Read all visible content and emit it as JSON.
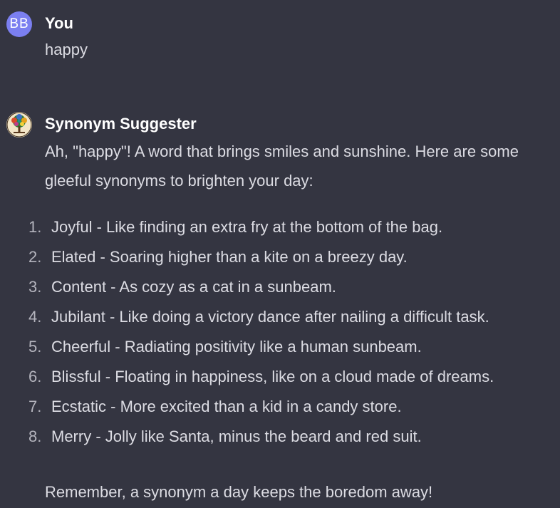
{
  "user_message": {
    "avatar_initials": "BB",
    "sender": "You",
    "text": "happy"
  },
  "assistant_message": {
    "avatar_icon": "tree-logo-icon",
    "sender": "Synonym Suggester",
    "intro": "Ah, \"happy\"! A word that brings smiles and sunshine. Here are some gleeful synonyms to brighten your day:",
    "items": [
      {
        "num": "1.",
        "text": "Joyful - Like finding an extra fry at the bottom of the bag."
      },
      {
        "num": "2.",
        "text": "Elated - Soaring higher than a kite on a breezy day."
      },
      {
        "num": "3.",
        "text": "Content - As cozy as a cat in a sunbeam."
      },
      {
        "num": "4.",
        "text": "Jubilant - Like doing a victory dance after nailing a difficult task."
      },
      {
        "num": "5.",
        "text": "Cheerful - Radiating positivity like a human sunbeam."
      },
      {
        "num": "6.",
        "text": "Blissful - Floating in happiness, like on a cloud made of dreams."
      },
      {
        "num": "7.",
        "text": "Ecstatic - More excited than a kid in a candy store."
      },
      {
        "num": "8.",
        "text": "Merry - Jolly like Santa, minus the beard and red suit."
      }
    ],
    "closing": "Remember, a synonym a day keeps the boredom away!"
  },
  "colors": {
    "background": "#343541",
    "user_avatar": "#7b7ff0",
    "text": "#dcdce3"
  }
}
